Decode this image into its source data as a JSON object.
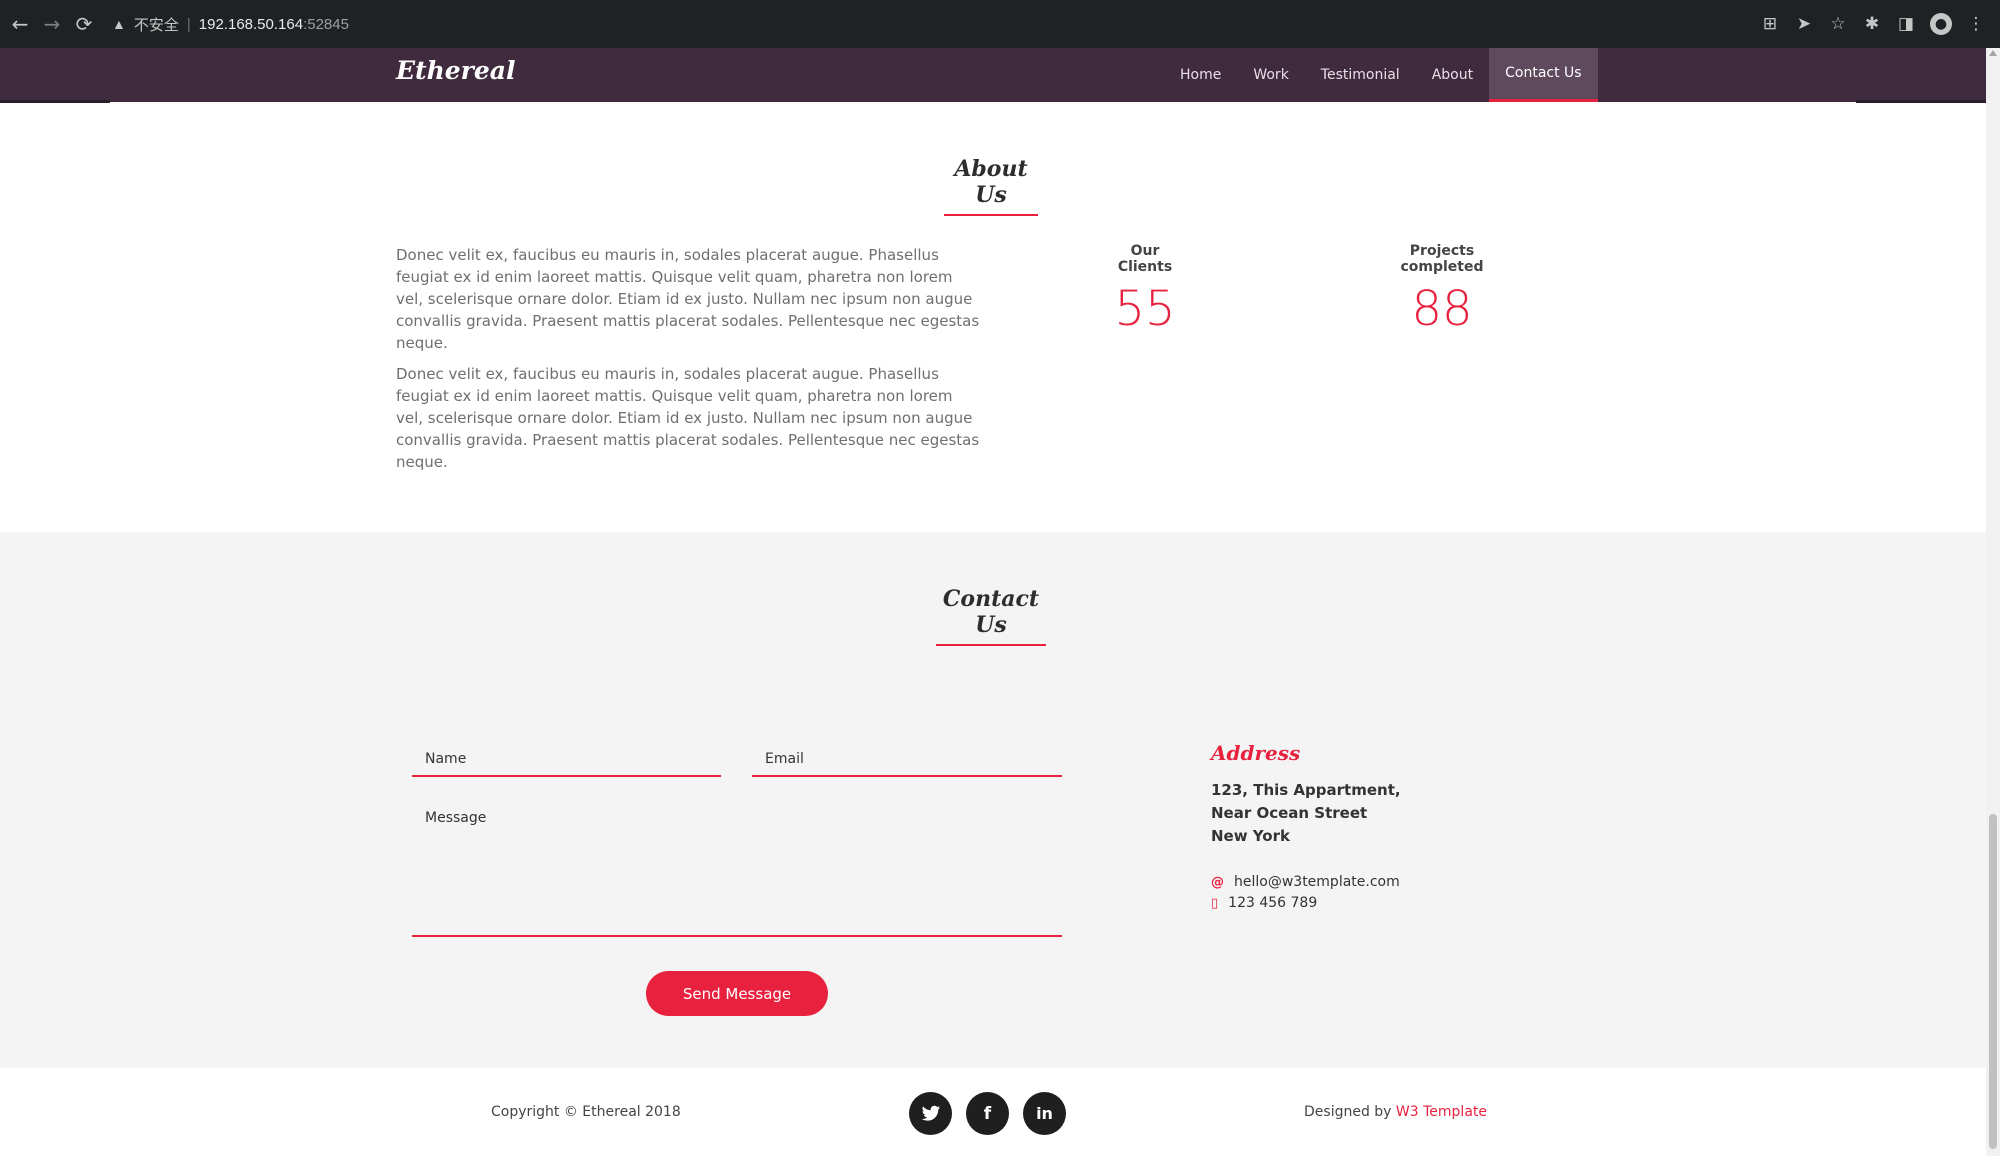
{
  "browser": {
    "security_label": "不安全",
    "host": "192.168.50.164",
    "port": ":52845"
  },
  "navbar": {
    "brand": "Ethereal",
    "items": [
      "Home",
      "Work",
      "Testimonial",
      "About",
      "Contact Us"
    ],
    "active_index": 4
  },
  "about": {
    "title": "About Us",
    "paragraphs": [
      "Donec velit ex, faucibus eu mauris in, sodales placerat augue. Phasellus feugiat ex id enim laoreet mattis. Quisque velit quam, pharetra non lorem vel, scelerisque ornare dolor. Etiam id ex justo. Nullam nec ipsum non augue convallis gravida. Praesent mattis placerat sodales. Pellentesque nec egestas neque.",
      "Donec velit ex, faucibus eu mauris in, sodales placerat augue. Phasellus feugiat ex id enim laoreet mattis. Quisque velit quam, pharetra non lorem vel, scelerisque ornare dolor. Etiam id ex justo. Nullam nec ipsum non augue convallis gravida. Praesent mattis placerat sodales. Pellentesque nec egestas neque."
    ],
    "stats": [
      {
        "label": "Our Clients",
        "value": "55"
      },
      {
        "label": "Projects completed",
        "value": "88"
      }
    ]
  },
  "contact": {
    "title": "Contact Us",
    "form": {
      "name_placeholder": "Name",
      "email_placeholder": "Email",
      "message_placeholder": "Message",
      "submit_label": "Send Message"
    },
    "address": {
      "title": "Address",
      "lines": [
        "123, This Appartment,",
        "Near Ocean Street",
        "New York"
      ],
      "email": "hello@w3template.com",
      "phone": "123 456 789"
    }
  },
  "footer": {
    "copyright": "Copyright © Ethereal 2018",
    "socials": [
      {
        "icon": "twitter-icon",
        "glyph": "🐦"
      },
      {
        "icon": "facebook-icon",
        "glyph": "f"
      },
      {
        "icon": "linkedin-icon",
        "glyph": "in"
      }
    ],
    "designed_by_prefix": "Designed by ",
    "designed_by_link": "W3 Template"
  },
  "colors": {
    "accent": "#e8213f",
    "navbar_bg": "#3f2b3d",
    "navbar_active_bg": "#5e4a5c",
    "contact_bg": "#f4f4f4"
  }
}
